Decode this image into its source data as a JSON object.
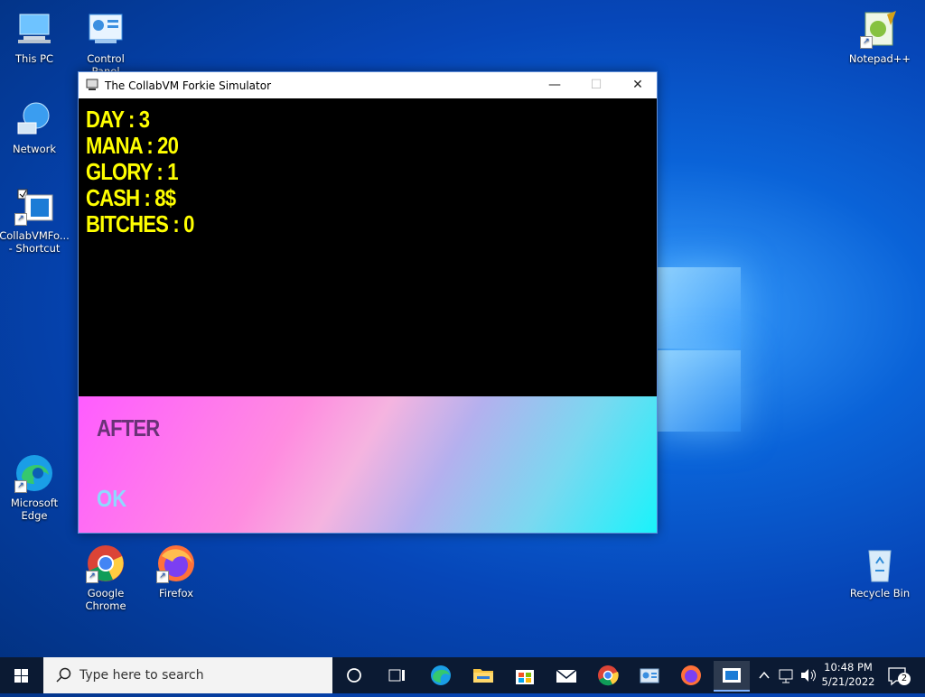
{
  "desktop": {
    "icons": [
      {
        "label": "This PC"
      },
      {
        "label": "Control Panel"
      },
      {
        "label": "Network"
      },
      {
        "label": "CollabVMFo... - Shortcut"
      },
      {
        "label": "Microsoft Edge"
      },
      {
        "label": "Google Chrome"
      },
      {
        "label": "Firefox"
      },
      {
        "label": "Notepad++"
      },
      {
        "label": "Recycle Bin"
      }
    ]
  },
  "window": {
    "title": "The CollabVM Forkie Simulator",
    "minimize_glyph": "—",
    "maximize_glyph": "☐",
    "close_glyph": "✕",
    "stats": [
      "DAY : 3",
      "MANA : 20",
      "GLORY : 1",
      "CASH : 8$",
      "BITCHES : 0"
    ],
    "panel": {
      "after_label": "AFTER",
      "ok_label": "OK"
    },
    "colors": {
      "stat_text": "#ffff00",
      "panel_gradient_start": "#ff5cff",
      "panel_gradient_end": "#19f3fb"
    }
  },
  "taskbar": {
    "search_placeholder": "Type here to search",
    "pinned": [
      "cortana-icon",
      "task-view-icon",
      "edge-icon",
      "file-explorer-icon",
      "store-icon",
      "mail-icon",
      "chrome-icon",
      "control-panel-icon",
      "firefox-icon",
      "collabvm-app-icon"
    ],
    "time": "10:48 PM",
    "date": "5/21/2022",
    "notification_count": "2"
  }
}
